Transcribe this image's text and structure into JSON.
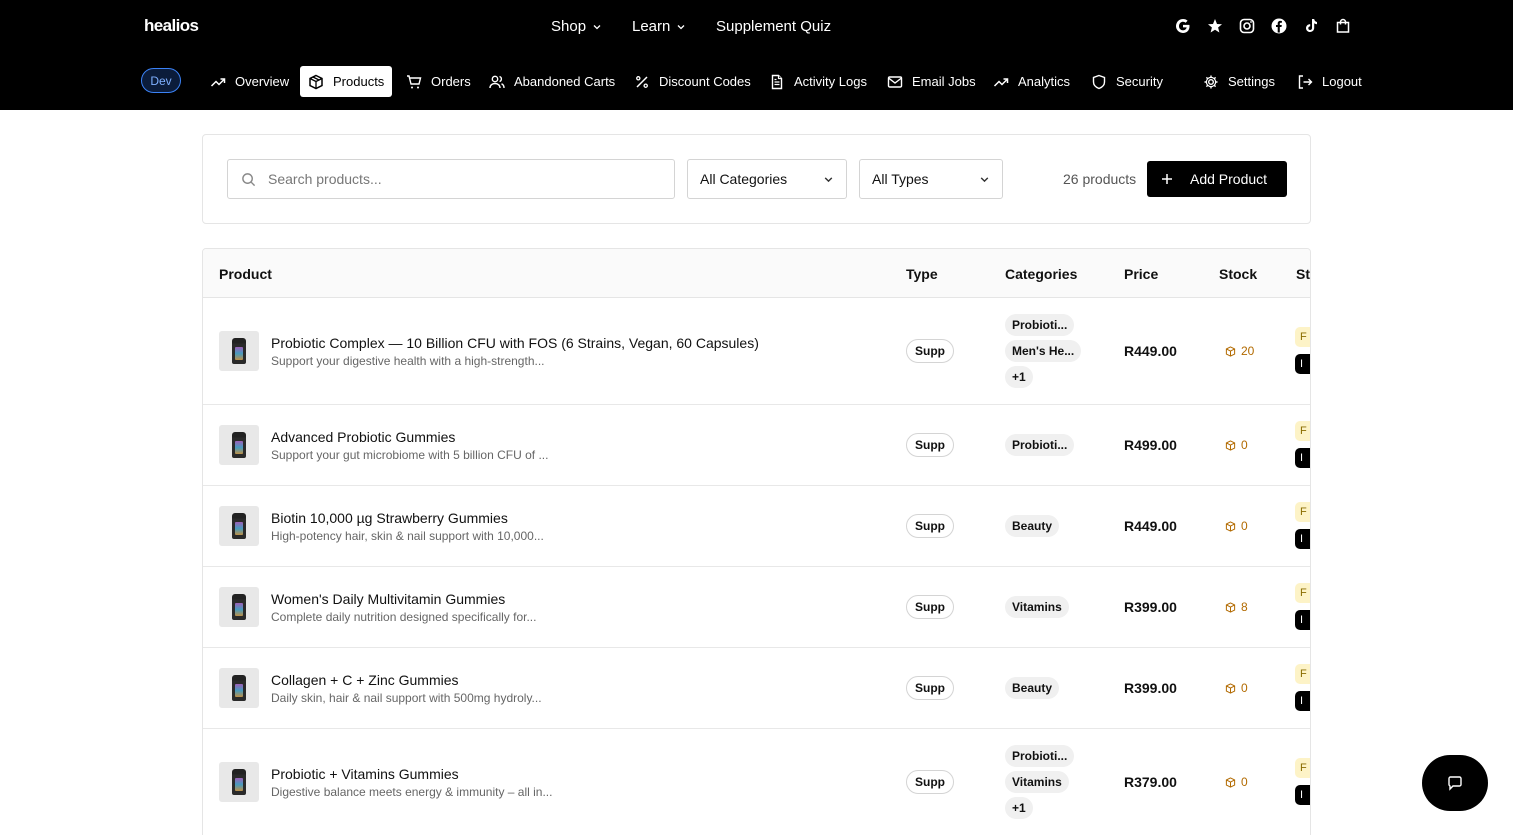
{
  "header": {
    "logo": "healios",
    "nav": [
      {
        "label": "Shop"
      },
      {
        "label": "Learn"
      },
      {
        "label": "Supplement Quiz"
      }
    ],
    "socials": [
      "google-icon",
      "star-icon",
      "instagram-icon",
      "facebook-icon",
      "tiktok-icon",
      "cart-icon"
    ]
  },
  "admin": {
    "env_badge": "Dev",
    "nav": [
      {
        "label": "Overview",
        "icon": "trend-icon"
      },
      {
        "label": "Products",
        "icon": "box-icon",
        "active": true
      },
      {
        "label": "Orders",
        "icon": "cart-icon"
      },
      {
        "label": "Abandoned Carts",
        "icon": "users-icon"
      },
      {
        "label": "Discount Codes",
        "icon": "percent-icon"
      },
      {
        "label": "Activity Logs",
        "icon": "document-icon"
      },
      {
        "label": "Email Jobs",
        "icon": "mail-icon"
      },
      {
        "label": "Analytics",
        "icon": "trend-icon"
      },
      {
        "label": "Security",
        "icon": "shield-icon"
      },
      {
        "label": "Settings",
        "icon": "gear-icon"
      },
      {
        "label": "Logout",
        "icon": "logout-icon"
      }
    ]
  },
  "filters": {
    "search_placeholder": "Search products...",
    "category_select": "All Categories",
    "type_select": "All Types",
    "count": "26 products",
    "add_label": "Add Product"
  },
  "table": {
    "columns": [
      "Product",
      "Type",
      "Categories",
      "Price",
      "Stock",
      "St"
    ],
    "rows": [
      {
        "name": "Probiotic Complex — 10 Billion CFU with FOS (6 Strains, Vegan, 60 Capsules)",
        "desc": "Support your digestive health with a high-strength...",
        "type": "Supp",
        "categories": [
          "Probioti...",
          "Men's He...",
          "+1"
        ],
        "price": "R449.00",
        "stock": "20",
        "status": [
          "F",
          "I"
        ]
      },
      {
        "name": "Advanced Probiotic Gummies",
        "desc": "Support your gut microbiome with 5 billion CFU of ...",
        "type": "Supp",
        "categories": [
          "Probioti..."
        ],
        "price": "R499.00",
        "stock": "0",
        "status": [
          "F",
          "I"
        ]
      },
      {
        "name": "Biotin 10,000 µg Strawberry Gummies",
        "desc": "High-potency hair, skin & nail support with 10,000...",
        "type": "Supp",
        "categories": [
          "Beauty"
        ],
        "price": "R449.00",
        "stock": "0",
        "status": [
          "F",
          "I"
        ]
      },
      {
        "name": "Women's Daily Multivitamin Gummies",
        "desc": "Complete daily nutrition designed specifically for...",
        "type": "Supp",
        "categories": [
          "Vitamins"
        ],
        "price": "R399.00",
        "stock": "8",
        "status": [
          "F",
          "I"
        ]
      },
      {
        "name": "Collagen + C + Zinc Gummies",
        "desc": "Daily skin, hair & nail support with 500mg hydroly...",
        "type": "Supp",
        "categories": [
          "Beauty"
        ],
        "price": "R399.00",
        "stock": "0",
        "status": [
          "F",
          "I"
        ]
      },
      {
        "name": "Probiotic + Vitamins Gummies",
        "desc": "Digestive balance meets energy & immunity – all in...",
        "type": "Supp",
        "categories": [
          "Probioti...",
          "Vitamins",
          "+1"
        ],
        "price": "R379.00",
        "stock": "0",
        "status": [
          "F",
          "I"
        ]
      }
    ]
  },
  "colors": {
    "header_bg": "#000000",
    "dev_badge_border": "#3b82f6",
    "stock_color": "#b26a00",
    "status_a_bg": "#fdf3c7"
  }
}
